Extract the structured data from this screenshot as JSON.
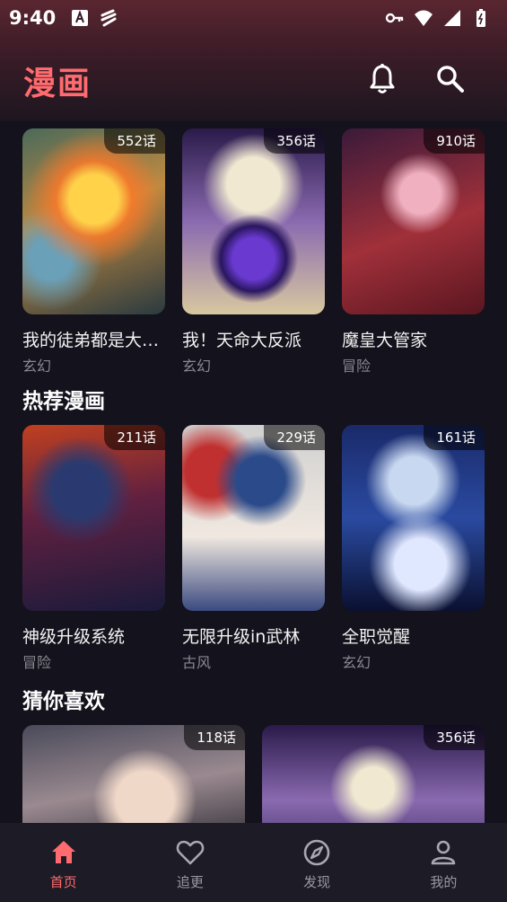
{
  "status": {
    "time": "9:40"
  },
  "header": {
    "title": "漫画"
  },
  "sections": [
    {
      "title": "",
      "items": [
        {
          "title": "我的徒弟都是大反派",
          "tag": "玄幻",
          "episodes": "552话"
        },
        {
          "title": "我！天命大反派",
          "tag": "玄幻",
          "episodes": "356话"
        },
        {
          "title": "魔皇大管家",
          "tag": "冒险",
          "episodes": "910话"
        }
      ]
    },
    {
      "title": "热荐漫画",
      "items": [
        {
          "title": "神级升级系统",
          "tag": "冒险",
          "episodes": "211话"
        },
        {
          "title": "无限升级in武林",
          "tag": "古风",
          "episodes": "229话"
        },
        {
          "title": "全职觉醒",
          "tag": "玄幻",
          "episodes": "161话"
        }
      ]
    },
    {
      "title": "猜你喜欢",
      "items": [
        {
          "episodes": "118话"
        },
        {
          "episodes": "356话"
        }
      ]
    }
  ],
  "nav": [
    {
      "label": "首页",
      "icon": "home-icon",
      "active": true
    },
    {
      "label": "追更",
      "icon": "heart-icon",
      "active": false
    },
    {
      "label": "发现",
      "icon": "compass-icon",
      "active": false
    },
    {
      "label": "我的",
      "icon": "person-icon",
      "active": false
    }
  ],
  "colors": {
    "accent": "#ff6b6f",
    "background": "#14121c",
    "nav_bg": "#1c1b26"
  }
}
